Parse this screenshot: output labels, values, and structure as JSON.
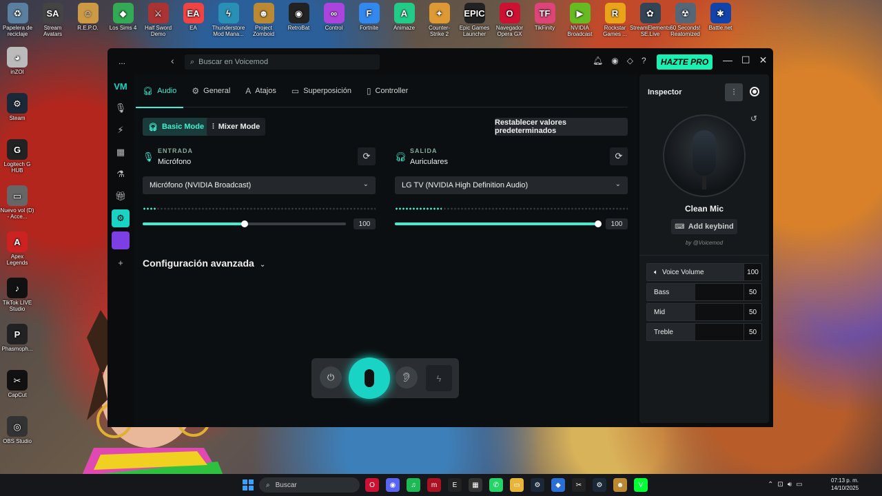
{
  "desktop": {
    "top_icons": [
      {
        "label": "Papelera de reciclaje",
        "glyph": "♻",
        "color": "#5a7fa0"
      },
      {
        "label": "Stream Avatars",
        "glyph": "SA",
        "color": "#444"
      },
      {
        "label": "R.E.P.O.",
        "glyph": "☺",
        "color": "#c94"
      },
      {
        "label": "Los Sims 4",
        "glyph": "◆",
        "color": "#3a5"
      },
      {
        "label": "Half Sword Demo",
        "glyph": "⚔",
        "color": "#a33"
      },
      {
        "label": "EA",
        "glyph": "EA",
        "color": "#e44"
      },
      {
        "label": "Thunderstore Mod Mana...",
        "glyph": "ϟ",
        "color": "#2a8fb5"
      },
      {
        "label": "Project Zomboid",
        "glyph": "☻",
        "color": "#b83"
      },
      {
        "label": "RetroBat",
        "glyph": "◉",
        "color": "#222"
      },
      {
        "label": "Control",
        "glyph": "∞",
        "color": "#a4d"
      },
      {
        "label": "Fortnite",
        "glyph": "F",
        "color": "#38e"
      },
      {
        "label": "Animaze",
        "glyph": "A",
        "color": "#2c8"
      },
      {
        "label": "Counter-Strike 2",
        "glyph": "✦",
        "color": "#d93"
      },
      {
        "label": "Epic Games Launcher",
        "glyph": "EPIC",
        "color": "#222"
      },
      {
        "label": "Navegador Opera GX",
        "glyph": "O",
        "color": "#c13"
      },
      {
        "label": "TikFinity",
        "glyph": "TF",
        "color": "#d47"
      },
      {
        "label": "NVIDIA Broadcast",
        "glyph": "▶",
        "color": "#6b2"
      },
      {
        "label": "Rockstar Games ...",
        "glyph": "R",
        "color": "#e9a41a"
      },
      {
        "label": "StreamElements SE.Live",
        "glyph": "✿",
        "color": "#345"
      },
      {
        "label": "60 Seconds! Reatomized",
        "glyph": "☢",
        "color": "#567"
      },
      {
        "label": "Battle.net",
        "glyph": "✱",
        "color": "#14a"
      }
    ],
    "left_icons": [
      {
        "label": "inZOI",
        "glyph": "◕",
        "color": "#bbb"
      },
      {
        "label": "Steam",
        "glyph": "⚙",
        "color": "#1b2838"
      },
      {
        "label": "Logitech G HUB",
        "glyph": "G",
        "color": "#222"
      },
      {
        "label": "Nuevo vol (D) - Acce...",
        "glyph": "▭",
        "color": "#666"
      },
      {
        "label": "Apex Legends",
        "glyph": "A",
        "color": "#c22"
      },
      {
        "label": "TikTok LIVE Studio",
        "glyph": "♪",
        "color": "#111"
      },
      {
        "label": "Phasmoph...",
        "glyph": "P",
        "color": "#222"
      },
      {
        "label": "CapCut",
        "glyph": "✂",
        "color": "#111"
      },
      {
        "label": "OBS Studio",
        "glyph": "◎",
        "color": "#333"
      }
    ]
  },
  "titlebar": {
    "menu": "...",
    "back": "‹",
    "search_placeholder": "Buscar en Voicemod",
    "pro_label": "HAZTE PRO",
    "icons": [
      "bell-icon",
      "discord-icon",
      "diamond-icon",
      "help-icon"
    ],
    "icon_glyphs": [
      "🔔︎",
      "◉",
      "◇",
      "?"
    ],
    "controls": [
      "—",
      "☐",
      "✕"
    ]
  },
  "tabs": [
    {
      "label": "Audio",
      "glyph": "🎧︎",
      "active": true
    },
    {
      "label": "General",
      "glyph": "⚙",
      "active": false
    },
    {
      "label": "Atajos",
      "glyph": "A",
      "active": false
    },
    {
      "label": "Superposición",
      "glyph": "▭",
      "active": false
    },
    {
      "label": "Controller",
      "glyph": "▯",
      "active": false
    }
  ],
  "modes": {
    "basic": "Basic Mode",
    "mixer": "Mixer Mode",
    "reset": "Restablecer valores predeterminados"
  },
  "input": {
    "section": "ENTRADA",
    "device_type": "Micrófono",
    "device": "Micrófono (NVIDIA Broadcast)",
    "volume": "100",
    "volume_fraction": 0.5,
    "meter_fraction": 0.06
  },
  "output": {
    "section": "SALIDA",
    "device_type": "Auriculares",
    "device": "LG TV (NVIDIA High Definition Audio)",
    "volume": "100",
    "volume_fraction": 1.0,
    "meter_fraction": 0.2
  },
  "advanced": {
    "label": "Configuración avanzada"
  },
  "inspector": {
    "title": "Inspector",
    "voice_name": "Clean Mic",
    "keybind": "Add keybind",
    "by": "by @Voicemod",
    "params": [
      {
        "label": "Voice Volume",
        "value": "100"
      },
      {
        "label": "Bass",
        "value": "50"
      },
      {
        "label": "Mid",
        "value": "50"
      },
      {
        "label": "Treble",
        "value": "50"
      }
    ]
  },
  "taskbar": {
    "search": "Buscar",
    "clock_time": "07:13 p. m.",
    "clock_date": "14/10/2025"
  },
  "colors": {
    "accent": "#3ff0d2",
    "pro": "#19f0b2"
  }
}
